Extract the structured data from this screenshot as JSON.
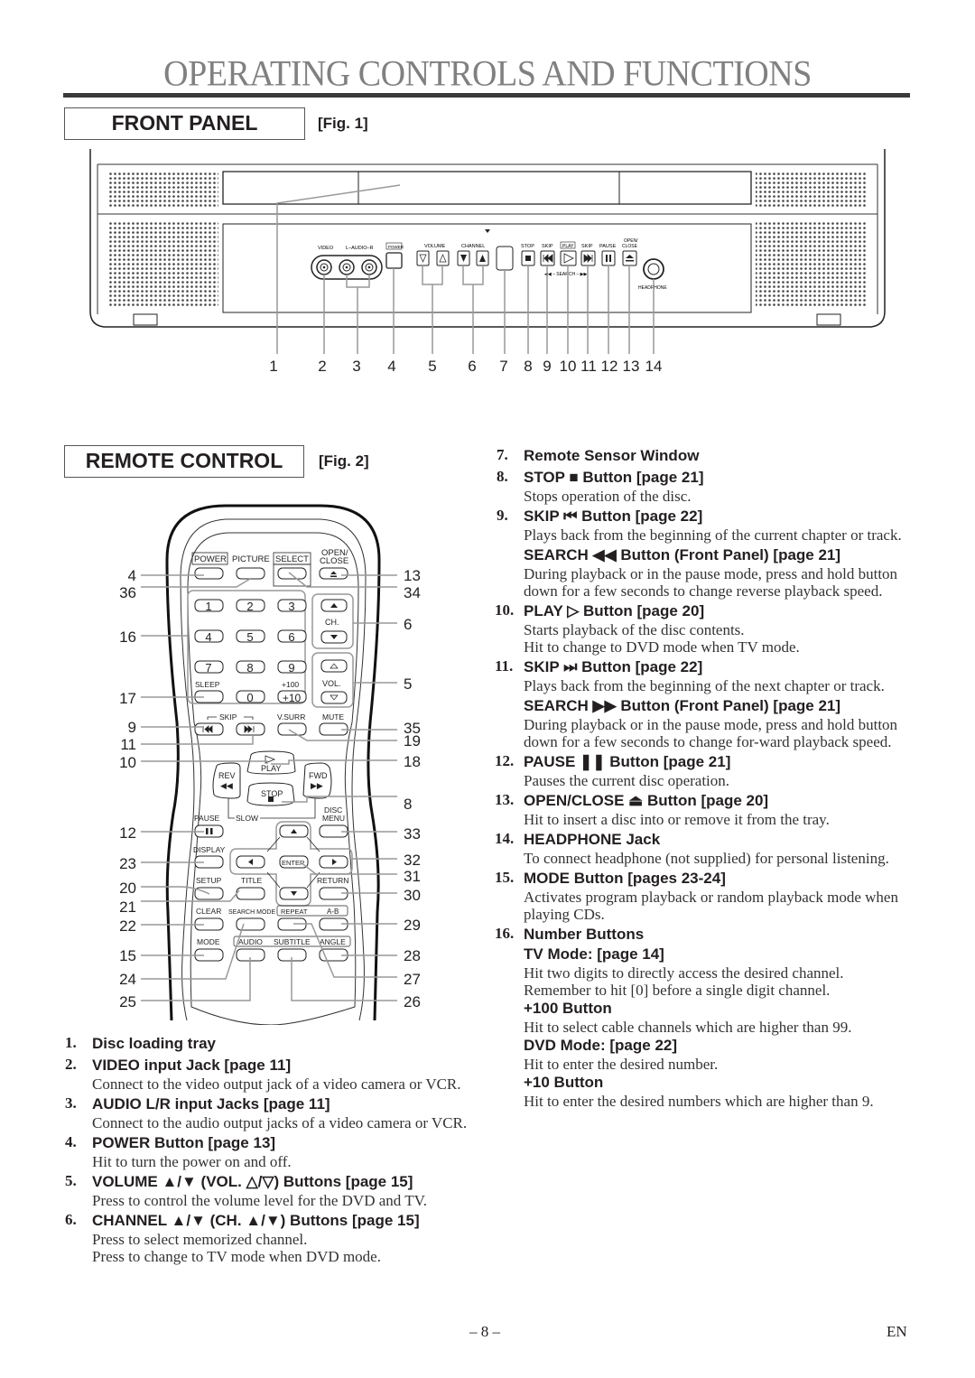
{
  "page": {
    "title": "OPERATING CONTROLS AND FUNCTIONS",
    "page_number": "– 8 –",
    "language": "EN"
  },
  "front_panel": {
    "section_label": "FRONT PANEL",
    "fig_label": "[Fig. 1]",
    "panel_labels": {
      "video": "VIDEO",
      "audio": "L–AUDIO–R",
      "power": "POWER",
      "volume": "VOLUME",
      "channel": "CHANNEL",
      "stop": "STOP",
      "skip_back": "SKIP",
      "play": "PLAY",
      "skip_fwd": "SKIP",
      "pause": "PAUSE",
      "open_close_1": "OPEN/",
      "open_close_2": "CLOSE",
      "search": "◀◀ – SEARCH – ▶▶",
      "headphone": "HEADPHONE"
    },
    "callouts": [
      "1",
      "2",
      "3",
      "4",
      "5",
      "6",
      "7",
      "8",
      "9",
      "10",
      "11",
      "12",
      "13",
      "14"
    ]
  },
  "remote_control": {
    "section_label": "REMOTE CONTROL",
    "fig_label": "[Fig. 2]",
    "labels": {
      "power": "POWER",
      "picture": "PICTURE",
      "select": "SELECT",
      "open1": "OPEN/",
      "open2": "CLOSE",
      "ch": "CH.",
      "vol": "VOL.",
      "sleep": "SLEEP",
      "plus100": "+100",
      "plus10": "+10",
      "skip": "SKIP",
      "vsurr": "V.SURR",
      "mute": "MUTE",
      "play": "PLAY",
      "rev": "REV",
      "fwd": "FWD",
      "stop": "STOP",
      "pause": "PAUSE",
      "slow": "SLOW",
      "disc1": "DISC",
      "disc2": "MENU",
      "display": "DISPLAY",
      "enter": "ENTER",
      "setup": "SETUP",
      "title": "TITLE",
      "return": "RETURN",
      "clear": "CLEAR",
      "search_mode": "SEARCH MODE",
      "repeat": "REPEAT",
      "ab": "A-B",
      "mode": "MODE",
      "audio": "AUDIO",
      "subtitle": "SUBTITLE",
      "angle": "ANGLE"
    },
    "digits": [
      "1",
      "2",
      "3",
      "4",
      "5",
      "6",
      "7",
      "8",
      "9",
      "0"
    ],
    "left_callouts": [
      "4",
      "36",
      "16",
      "17",
      "9",
      "11",
      "10",
      "12",
      "23",
      "20",
      "21",
      "22",
      "15",
      "24",
      "25"
    ],
    "right_callouts": [
      "13",
      "34",
      "6",
      "5",
      "35",
      "19",
      "18",
      "8",
      "33",
      "32",
      "31",
      "30",
      "29",
      "28",
      "27",
      "26"
    ]
  },
  "left_items": [
    {
      "num": "1.",
      "head": "Disc loading tray",
      "desc": []
    },
    {
      "num": "2.",
      "head": "VIDEO input Jack [page 11]",
      "desc": [
        "Connect to the video output jack of a video camera or VCR."
      ]
    },
    {
      "num": "3.",
      "head": "AUDIO L/R input Jacks [page 11]",
      "desc": [
        "Connect to the audio output jacks of a video camera or VCR."
      ]
    },
    {
      "num": "4.",
      "head": "POWER Button [page 13]",
      "desc": [
        "Hit to turn the power on and off."
      ]
    },
    {
      "num": "5.",
      "head": "VOLUME ▲/▼ (VOL. △/▽) Buttons [page 15]",
      "desc": [
        "Press to control the volume level for the DVD and TV."
      ]
    },
    {
      "num": "6.",
      "head": "CHANNEL ▲/▼ (CH. ▲/▼) Buttons [page 15]",
      "desc": [
        "Press to select memorized channel.",
        "Press to change to TV mode when DVD mode."
      ]
    }
  ],
  "right_items": [
    {
      "num": "7.",
      "head": "Remote Sensor Window",
      "desc": []
    },
    {
      "num": "8.",
      "head": "STOP ■ Button [page 21]",
      "desc": [
        "Stops operation of the disc."
      ]
    },
    {
      "num": "9.",
      "head": "SKIP ⏮ Button [page 22]",
      "desc": [
        "Plays back from the beginning of the current chapter or track."
      ],
      "extra": {
        "head": "SEARCH ◀◀ Button (Front Panel) [page 21]",
        "desc": "During playback or in the pause mode, press and hold button down for a few seconds to change reverse playback speed."
      }
    },
    {
      "num": "10.",
      "head": "PLAY ▷ Button [page 20]",
      "desc": [
        "Starts playback of the disc contents.",
        "Hit to change to DVD mode when TV mode."
      ]
    },
    {
      "num": "11.",
      "head": "SKIP ⏭ Button [page 22]",
      "desc": [
        "Plays back from the beginning of the next chapter or track."
      ],
      "extra": {
        "head": "SEARCH ▶▶ Button (Front Panel) [page 21]",
        "desc": "During playback or in the pause mode, press and hold button down for a few seconds to change for-ward playback speed."
      }
    },
    {
      "num": "12.",
      "head": "PAUSE ❚❚ Button [page 21]",
      "desc": [
        "Pauses the current disc operation."
      ]
    },
    {
      "num": "13.",
      "head": "OPEN/CLOSE ⏏ Button [page 20]",
      "desc": [
        "Hit to insert a disc into or remove it from the tray."
      ]
    },
    {
      "num": "14.",
      "head": "HEADPHONE Jack",
      "desc": [
        "To connect headphone (not supplied) for personal listening."
      ]
    },
    {
      "num": "15.",
      "head": "MODE Button [pages 23-24]",
      "desc": [
        "Activates program playback or random playback mode when playing CDs."
      ]
    }
  ],
  "item16": {
    "num": "16.",
    "head": "Number Buttons",
    "tv_head": "TV Mode: [page 14]",
    "tv_desc1": "Hit two digits to directly access the desired channel.",
    "tv_desc2": "Remember to hit [0] before a single digit channel.",
    "p100_head": "+100 Button",
    "p100_desc": "Hit to select cable channels which are higher than 99.",
    "dvd_head": "DVD Mode: [page 22]",
    "dvd_desc": "Hit to enter the desired number.",
    "p10_head": "+10 Button",
    "p10_desc": "Hit to enter the desired numbers which are higher than 9."
  }
}
